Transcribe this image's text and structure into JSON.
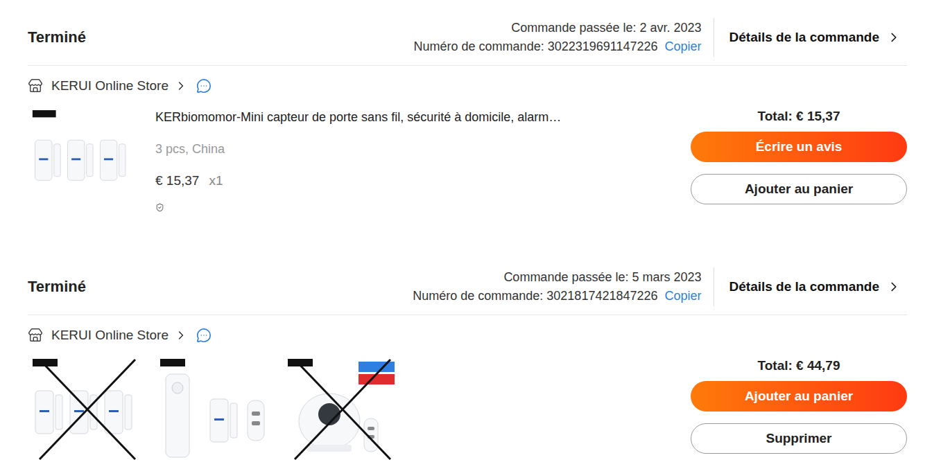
{
  "orders": [
    {
      "status": "Terminé",
      "date_label": "Commande passée le: 2 avr. 2023",
      "number_label": "Numéro de commande: 3022319691147226",
      "copy": "Copier",
      "details": "Détails de la commande",
      "store": "KERUI Online Store",
      "kind": "single",
      "images": [
        {
          "kind": "sensors",
          "crossed": false
        }
      ],
      "product": {
        "title": "KERbiomomor-Mini capteur de porte sans fil, sécurité à domicile, alarm…",
        "variant": "3 pcs, China",
        "price": "€ 15,37",
        "quantity": "x1"
      },
      "total": "Total: € 15,37",
      "buttons": [
        {
          "label": "Écrire un avis",
          "kind": "primary"
        },
        {
          "label": "Ajouter au panier",
          "kind": "outline"
        }
      ]
    },
    {
      "status": "Terminé",
      "date_label": "Commande passée le: 5 mars 2023",
      "number_label": "Numéro de commande: 3021817421847226",
      "copy": "Copier",
      "details": "Détails de la commande",
      "store": "KERUI Online Store",
      "kind": "multi",
      "images": [
        {
          "kind": "sensors",
          "crossed": true
        },
        {
          "kind": "alarm",
          "crossed": false
        },
        {
          "kind": "siren",
          "crossed": true
        }
      ],
      "total": "Total: € 44,79",
      "buttons": [
        {
          "label": "Ajouter au panier",
          "kind": "primary"
        },
        {
          "label": "Supprimer",
          "kind": "outline"
        }
      ]
    }
  ]
}
